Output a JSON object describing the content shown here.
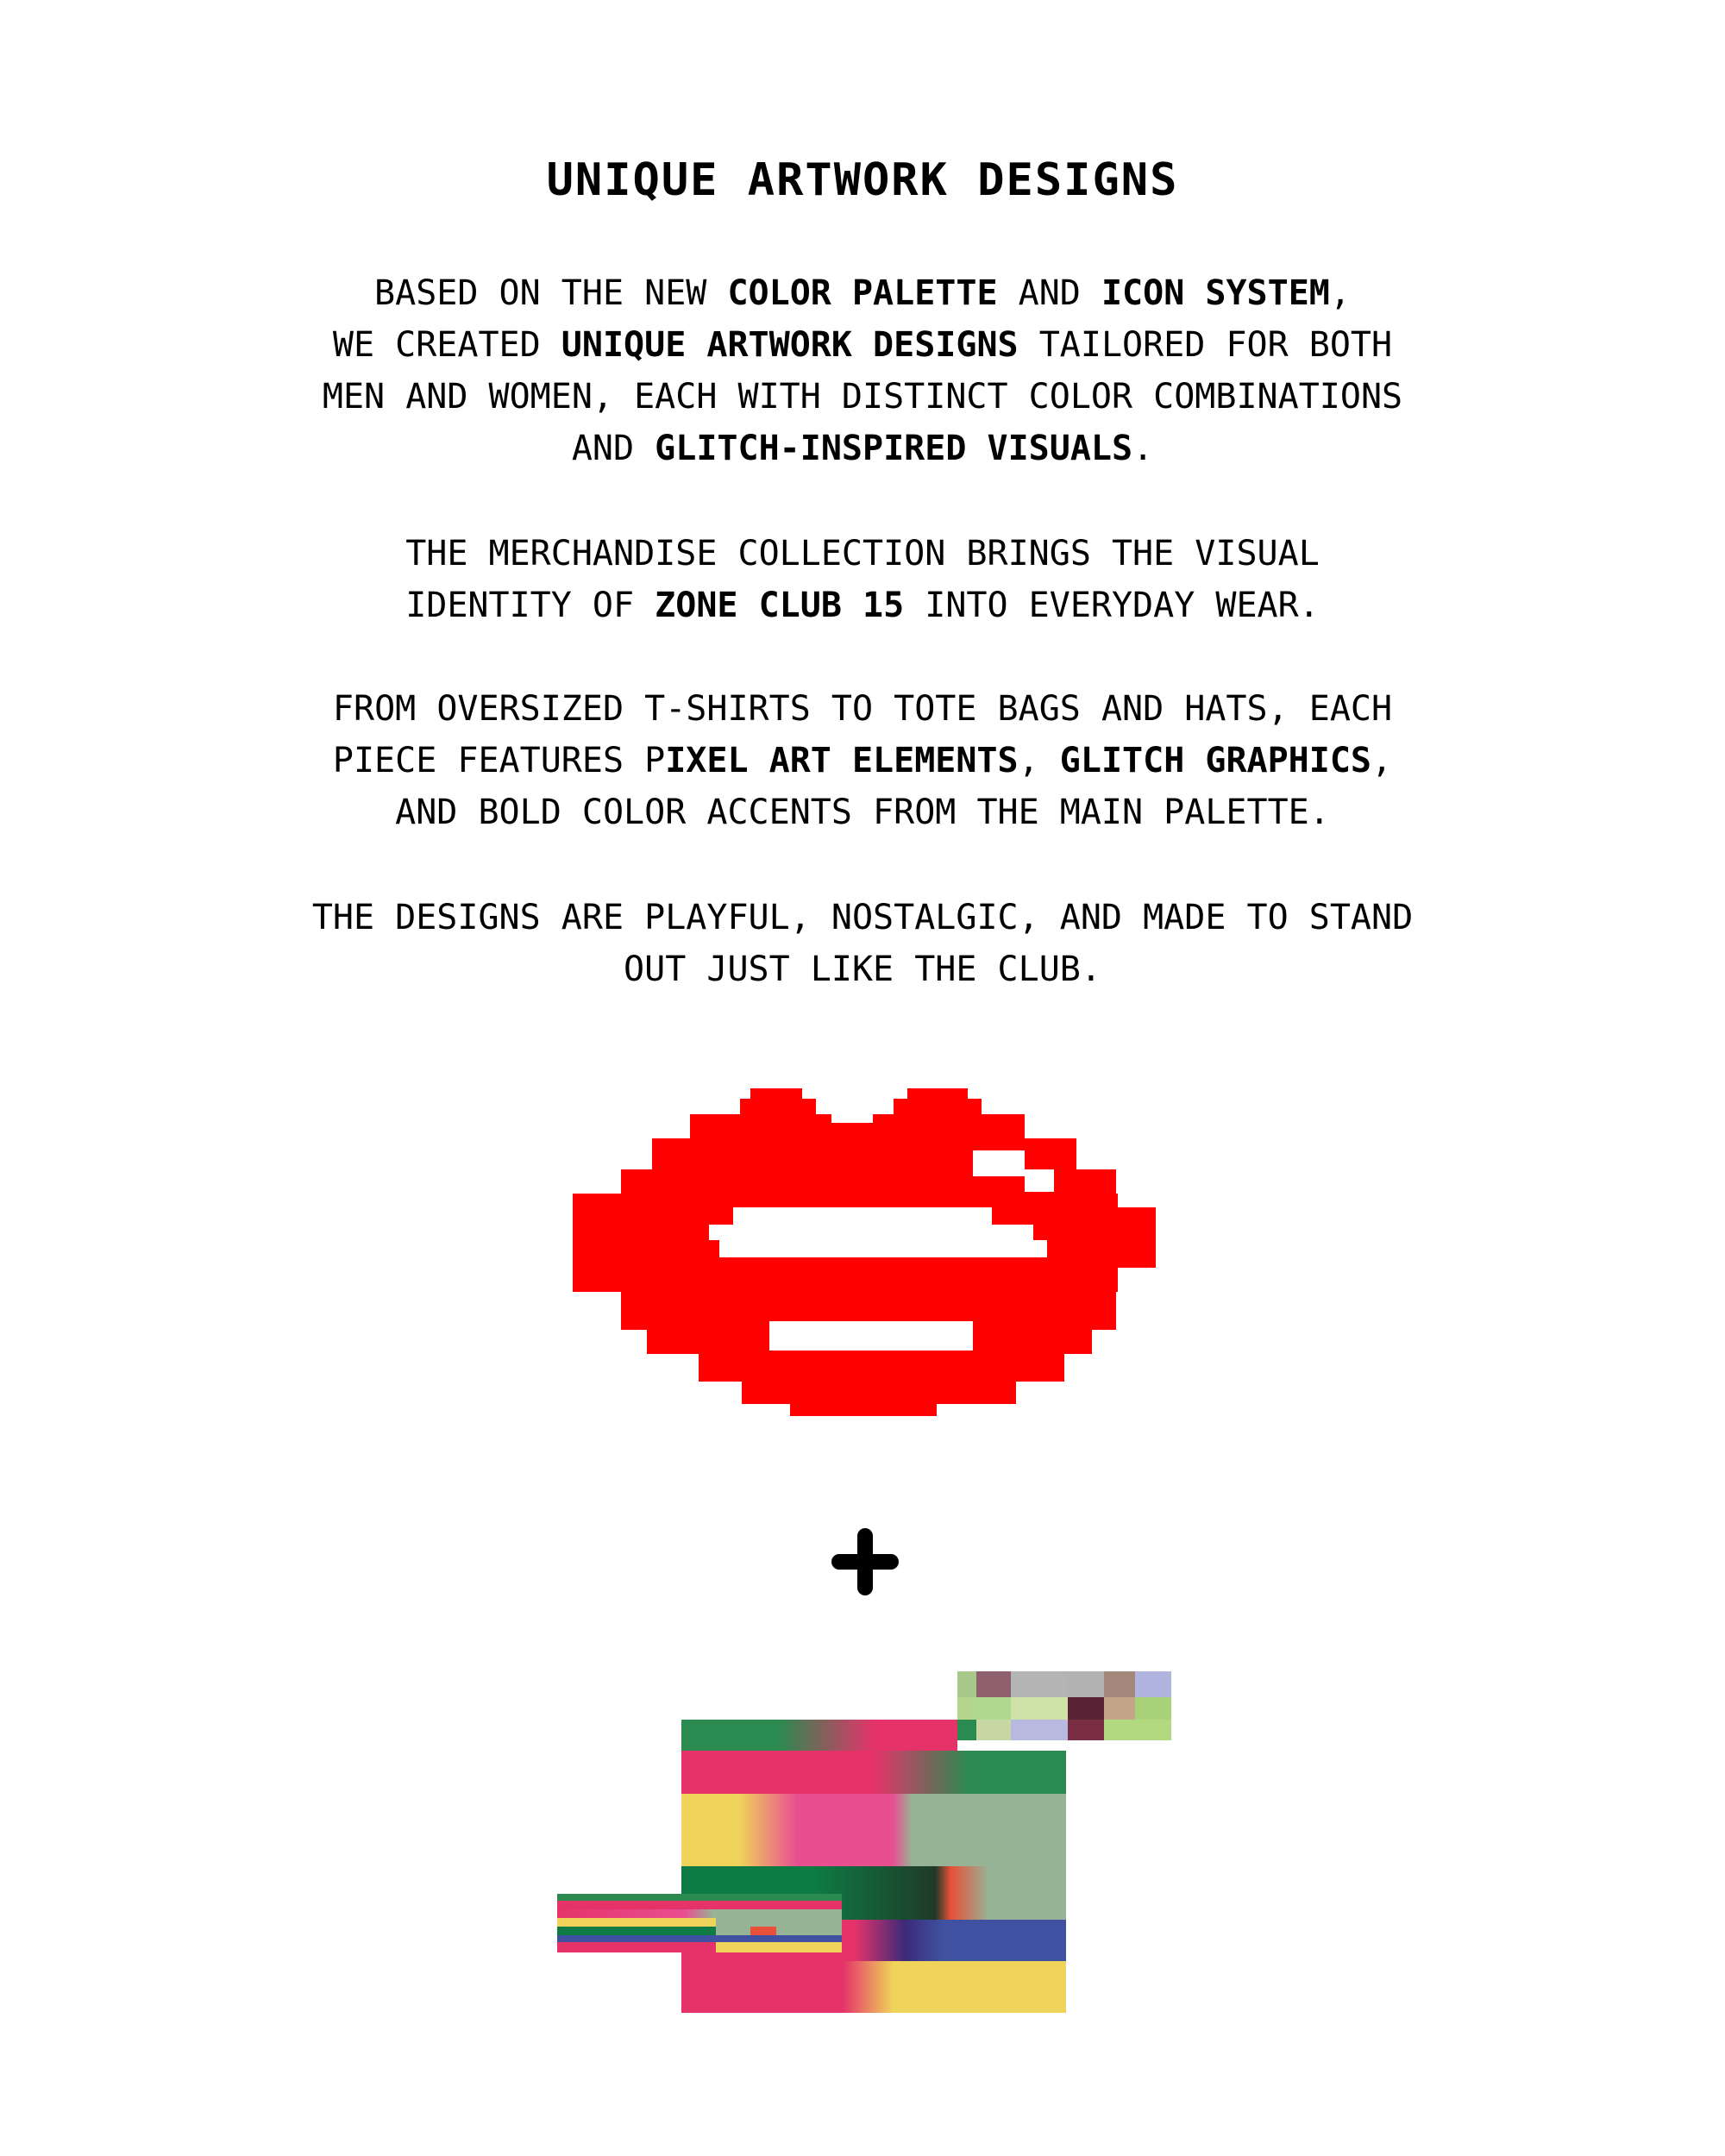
{
  "heading": "Unique artwork designs",
  "paragraphs": [
    {
      "lines": [
        [
          {
            "t": "Based on the new ",
            "b": false
          },
          {
            "t": "color palette",
            "b": true
          },
          {
            "t": " and ",
            "b": false
          },
          {
            "t": "icon system",
            "b": true
          },
          {
            "t": ",",
            "b": false
          }
        ],
        [
          {
            "t": "we created ",
            "b": false
          },
          {
            "t": "unique artwork designs",
            "b": true
          },
          {
            "t": " tailored for both",
            "b": false
          }
        ],
        [
          {
            "t": "men and women, each with distinct color combinations",
            "b": false
          }
        ],
        [
          {
            "t": "and ",
            "b": false
          },
          {
            "t": "glitch-inspired visuals",
            "b": true
          },
          {
            "t": ".",
            "b": false
          }
        ]
      ]
    },
    {
      "lines": [
        [
          {
            "t": "The merchandise collection brings the visual",
            "b": false
          }
        ],
        [
          {
            "t": "identity of ",
            "b": false
          },
          {
            "t": "Zone Club 15",
            "b": true
          },
          {
            "t": " into everyday wear.",
            "b": false
          }
        ]
      ]
    },
    {
      "lines": [
        [
          {
            "t": "From oversized T-shirts to tote bags and hats, each",
            "b": false
          }
        ],
        [
          {
            "t": "piece features p",
            "b": false
          },
          {
            "t": "ixel art elements",
            "b": true
          },
          {
            "t": ", ",
            "b": false
          },
          {
            "t": "glitch graphics",
            "b": true
          },
          {
            "t": ",",
            "b": false
          }
        ],
        [
          {
            "t": "and bold color accents from the main palette.",
            "b": false
          }
        ]
      ]
    },
    {
      "lines": [
        [
          {
            "t": "The designs are playful, nostalgic, and made to stand",
            "b": false
          }
        ],
        [
          {
            "t": "out just like the club.",
            "b": false
          }
        ]
      ]
    }
  ],
  "icons": {
    "lips": "pixel-lips-icon",
    "plus": "plus-icon",
    "glitch": "glitch-art-icon"
  },
  "colors": {
    "lips_red": "#ff0000",
    "text": "#000000",
    "background": "#ffffff",
    "glitch_pink": "#e5336a",
    "glitch_green": "#2a8a4f",
    "glitch_yellow": "#f0d35a",
    "glitch_sage": "#97b396",
    "glitch_blue": "#3f51a0"
  }
}
